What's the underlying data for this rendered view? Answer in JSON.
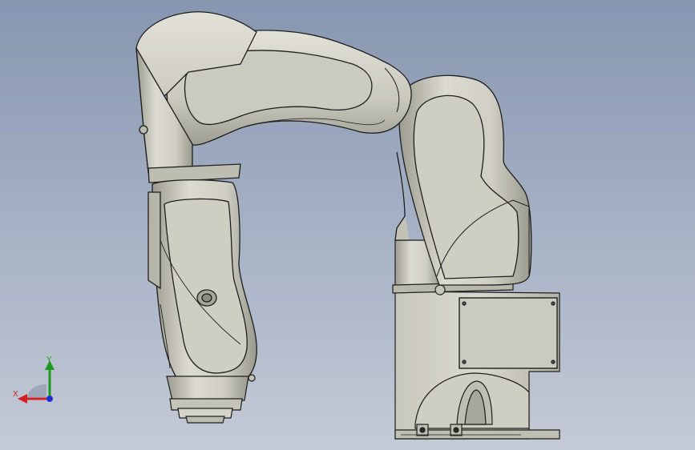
{
  "viewport": {
    "background_top": "#8796b0",
    "background_bottom": "#c4cad6"
  },
  "model": {
    "type": "6-axis robot arm",
    "body_color": "#d2d1c6",
    "shade_color": "#a9a89c",
    "edge_color": "#1e1e1e"
  },
  "triad": {
    "x_label": "X",
    "y_label": "Y",
    "x_color": "#d32020",
    "y_color": "#1d9a1d",
    "z_color": "#2030d0"
  }
}
